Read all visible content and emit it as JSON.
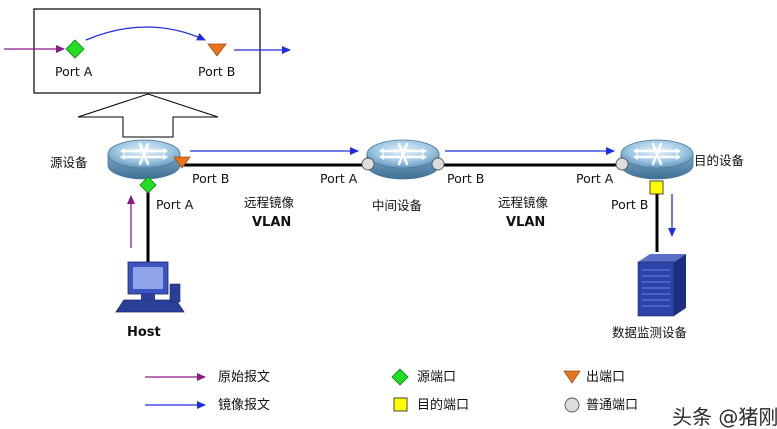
{
  "colors": {
    "original_arrow": "#8b1a8b",
    "mirror_arrow": "#1e2ee0",
    "source_port": "#22dd22",
    "egress_port": "#e8741c",
    "dest_port": "#ffff00",
    "normal_port": "#dddddd",
    "switch_fill": "#9dc6e2",
    "link": "#000000"
  },
  "inset": {
    "port_a_label": "Port A",
    "port_b_label": "Port B"
  },
  "devices": {
    "source": {
      "label": "源设备",
      "port_a": "Port A",
      "port_b": "Port B",
      "icon": "switch-icon"
    },
    "middle": {
      "label": "中间设备",
      "port_a": "Port A",
      "port_b": "Port B",
      "icon": "switch-icon"
    },
    "dest": {
      "label": "目的设备",
      "port_a": "Port A",
      "port_b": "Port B",
      "icon": "switch-icon"
    },
    "host": {
      "label": "Host",
      "icon": "computer-icon"
    },
    "monitor": {
      "label": "数据监测设备",
      "icon": "server-icon"
    }
  },
  "links": {
    "vlan1": {
      "line1": "远程镜像",
      "line2": "VLAN"
    },
    "vlan2": {
      "line1": "远程镜像",
      "line2": "VLAN"
    }
  },
  "legend": {
    "original": "原始报文",
    "mirror": "镜像报文",
    "source_port": "源端口",
    "dest_port": "目的端口",
    "egress_port": "出端口",
    "normal_port": "普通端口"
  },
  "watermark": "头条 @猪刚"
}
